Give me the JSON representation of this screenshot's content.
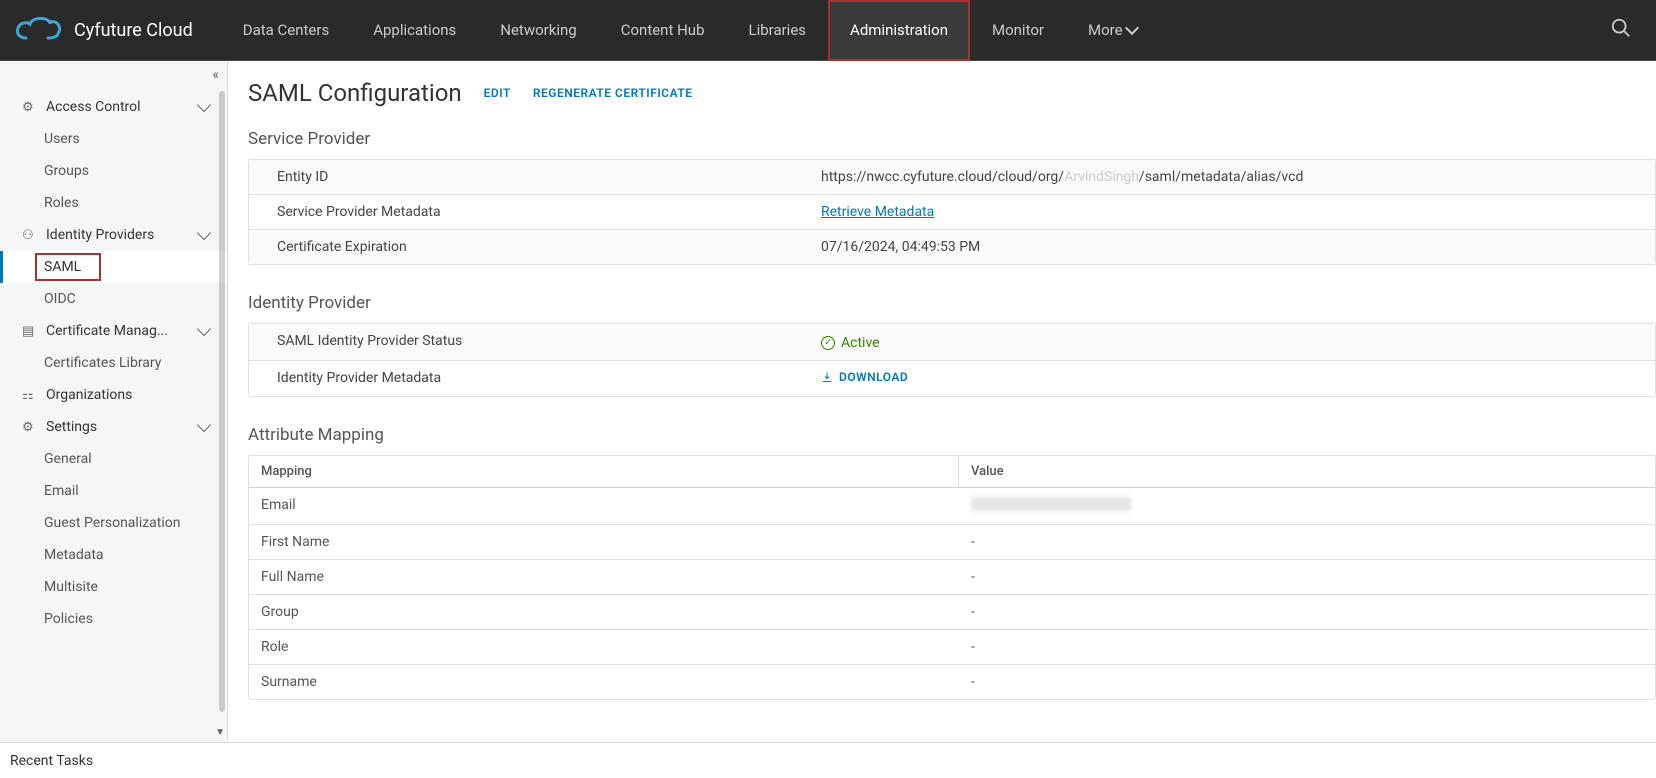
{
  "brand": "Cyfuture Cloud",
  "topnav": {
    "items": [
      "Data Centers",
      "Applications",
      "Networking",
      "Content Hub",
      "Libraries",
      "Administration",
      "Monitor"
    ],
    "more": "More"
  },
  "sidebar": {
    "access_control": {
      "label": "Access Control",
      "users": "Users",
      "groups": "Groups",
      "roles": "Roles"
    },
    "identity_providers": {
      "label": "Identity Providers",
      "saml": "SAML",
      "oidc": "OIDC"
    },
    "cert_mgmt": {
      "label": "Certificate Manag...",
      "lib": "Certificates Library"
    },
    "organizations": "Organizations",
    "settings": {
      "label": "Settings",
      "general": "General",
      "email": "Email",
      "guest": "Guest Personalization",
      "metadata": "Metadata",
      "multisite": "Multisite",
      "policies": "Policies"
    }
  },
  "page": {
    "title": "SAML Configuration",
    "edit": "EDIT",
    "regen": "REGENERATE CERTIFICATE"
  },
  "service_provider": {
    "title": "Service Provider",
    "entity_id_label": "Entity ID",
    "entity_id_value_prefix": "https://nwcc.cyfuture.cloud/cloud/org/",
    "entity_id_value_mid": "ArvindSingh",
    "entity_id_value_suffix": "/saml/metadata/alias/vcd",
    "sp_meta_label": "Service Provider Metadata",
    "sp_meta_link": "Retrieve Metadata",
    "cert_exp_label": "Certificate Expiration",
    "cert_exp_value": "07/16/2024, 04:49:53 PM"
  },
  "identity_provider": {
    "title": "Identity Provider",
    "status_label": "SAML Identity Provider Status",
    "status_value": "Active",
    "meta_label": "Identity Provider Metadata",
    "download": "DOWNLOAD"
  },
  "attribute_mapping": {
    "title": "Attribute Mapping",
    "col_mapping": "Mapping",
    "col_value": "Value",
    "rows": [
      {
        "m": "Email",
        "v": ""
      },
      {
        "m": "First Name",
        "v": "-"
      },
      {
        "m": "Full Name",
        "v": "-"
      },
      {
        "m": "Group",
        "v": "-"
      },
      {
        "m": "Role",
        "v": "-"
      },
      {
        "m": "Surname",
        "v": "-"
      }
    ]
  },
  "recent_tasks": "Recent Tasks"
}
